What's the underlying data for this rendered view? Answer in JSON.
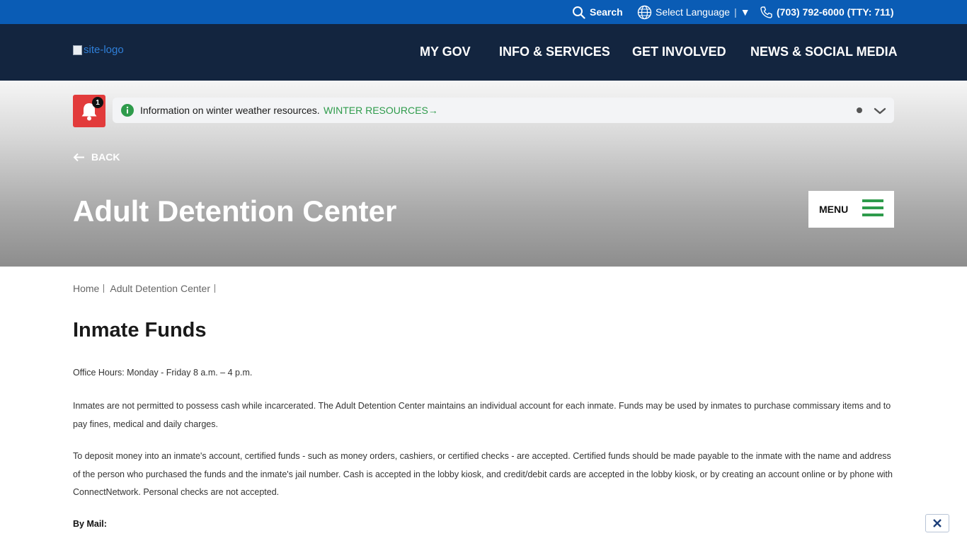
{
  "utility": {
    "search_label": "Search",
    "language_label": "Select Language",
    "language_sep": "|",
    "language_arrow": "▼",
    "phone": "(703) 792-6000 (TTY: 711)"
  },
  "header": {
    "logo_alt": "site-logo",
    "nav": [
      "MY GOV",
      "INFO & SERVICES",
      "GET INVOLVED",
      "NEWS & SOCIAL MEDIA"
    ]
  },
  "alert": {
    "count": "1",
    "text": "Information on winter weather resources.",
    "link_label": "WINTER RESOURCES",
    "link_arrow": "→"
  },
  "hero": {
    "back_label": "BACK",
    "title": "Adult Detention Center",
    "menu_label": "MENU"
  },
  "breadcrumb": [
    "Home",
    "Adult Detention Center"
  ],
  "content": {
    "title": "Inmate Funds",
    "paragraphs": [
      "Office Hours: Monday - Friday 8 a.m. – 4 p.m.",
      "Inmates are not permitted to possess cash while incarcerated. The Adult Detention Center maintains an individual account for each inmate. Funds may be used by inmates to purchase commissary items and to pay fines, medical and daily charges.",
      "To deposit money into an inmate's account, certified funds - such as money orders, cashiers, or certified checks - are accepted. Certified funds should be made payable to the inmate with the name and address of the person who purchased the funds and the inmate's jail number.  Cash is accepted in the lobby kiosk, and credit/debit cards are accepted in the lobby kiosk, or by creating an account online or by phone with ConnectNetwork. Personal checks are not accepted."
    ],
    "by_mail_label": "By Mail:"
  },
  "colors": {
    "utility_bar": "#0a5cb5",
    "nav_bar": "#13253f",
    "accent_green": "#2e9b4b",
    "alert_red": "#e23b3b"
  },
  "icons": [
    "search-icon",
    "globe-icon",
    "phone-icon",
    "bell-icon",
    "info-icon",
    "chevron-down-icon",
    "arrow-left-icon",
    "hamburger-icon",
    "close-icon"
  ]
}
